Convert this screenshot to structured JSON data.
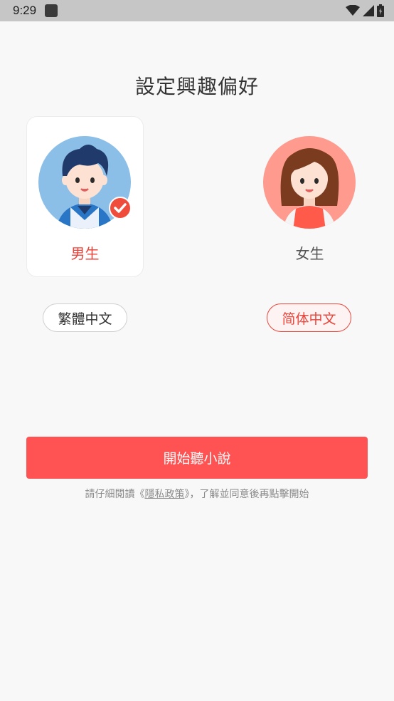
{
  "status_bar": {
    "time": "9:29"
  },
  "page": {
    "title": "設定興趣偏好"
  },
  "gender": {
    "male_label": "男生",
    "female_label": "女生",
    "selected": "male"
  },
  "language": {
    "traditional_label": "繁體中文",
    "simplified_label": "简体中文",
    "selected": "simplified"
  },
  "start_button": {
    "label": "開始聽小說"
  },
  "privacy": {
    "prefix": "請仔細閱讀《",
    "link": "隱私政策",
    "suffix": "》，了解並同意後再點擊開始"
  },
  "colors": {
    "accent": "#ff5252",
    "selected_text": "#e8453c",
    "male_avatar_bg": "#8bbfe8",
    "female_avatar_bg": "#fe9a8e"
  }
}
